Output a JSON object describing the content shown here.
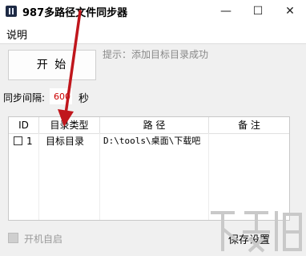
{
  "window": {
    "title": "987多路径文件同步器",
    "icon": "app-icon",
    "minimize_glyph": "—",
    "maximize_glyph": "☐",
    "close_glyph": "✕"
  },
  "menu": {
    "items": [
      {
        "label": "说明"
      }
    ]
  },
  "controls": {
    "start_label": "开 始",
    "hint": "提示：添加目标目录成功",
    "interval_label": "同步间隔:",
    "interval_value": "600",
    "interval_unit": "秒",
    "autostart_label": "开机自启",
    "autostart_checked": false,
    "save_label": "保存设置"
  },
  "table": {
    "headers": [
      "ID",
      "目录类型",
      "路 径",
      "备 注"
    ],
    "rows": [
      {
        "checked": false,
        "id": "1",
        "type": "目标目录",
        "path": "D:\\tools\\桌面\\下载吧",
        "note": ""
      }
    ]
  },
  "overlay": {
    "arrow_color": "#c0161c",
    "watermark_color": "#c9c9c9"
  }
}
